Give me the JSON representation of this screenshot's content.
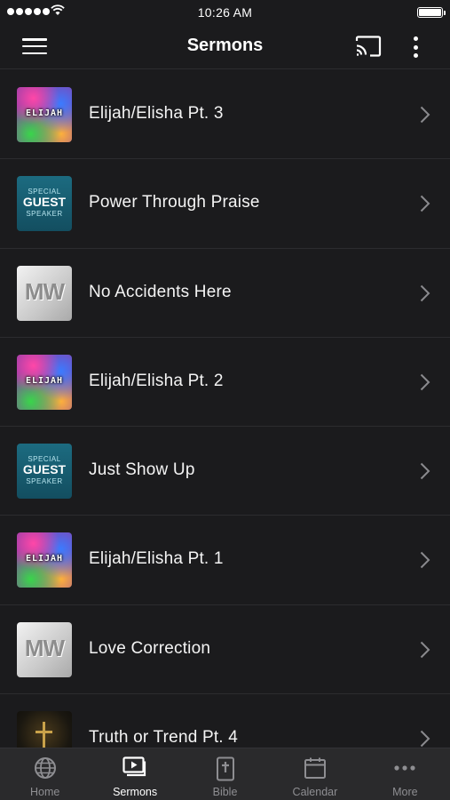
{
  "status_bar": {
    "time": "10:26 AM"
  },
  "navbar": {
    "title": "Sermons"
  },
  "sermons": [
    {
      "title": "Elijah/Elisha Pt. 3",
      "thumb": "elijah",
      "thumb_text": "ELIJAH"
    },
    {
      "title": "Power Through Praise",
      "thumb": "guest",
      "thumb_text": [
        "SPECIAL",
        "GUEST",
        "SPEAKER"
      ]
    },
    {
      "title": "No Accidents Here",
      "thumb": "mw",
      "thumb_text": "MW"
    },
    {
      "title": "Elijah/Elisha Pt. 2",
      "thumb": "elijah",
      "thumb_text": "ELIJAH"
    },
    {
      "title": "Just Show Up",
      "thumb": "guest",
      "thumb_text": [
        "SPECIAL",
        "GUEST",
        "SPEAKER"
      ]
    },
    {
      "title": "Elijah/Elisha Pt. 1",
      "thumb": "elijah",
      "thumb_text": "ELIJAH"
    },
    {
      "title": "Love Correction",
      "thumb": "mw",
      "thumb_text": "MW"
    },
    {
      "title": "Truth or Trend Pt. 4",
      "thumb": "cross"
    }
  ],
  "tabs": [
    {
      "label": "Home",
      "icon": "globe-icon",
      "active": false
    },
    {
      "label": "Sermons",
      "icon": "video-stack-icon",
      "active": true
    },
    {
      "label": "Bible",
      "icon": "bible-icon",
      "active": false
    },
    {
      "label": "Calendar",
      "icon": "calendar-icon",
      "active": false
    },
    {
      "label": "More",
      "icon": "ellipsis-icon",
      "active": false
    }
  ],
  "colors": {
    "background": "#1b1b1d",
    "tab_bar": "#2a2a2c",
    "active_tab": "#ffffff",
    "inactive_tab": "#8e8e92"
  }
}
